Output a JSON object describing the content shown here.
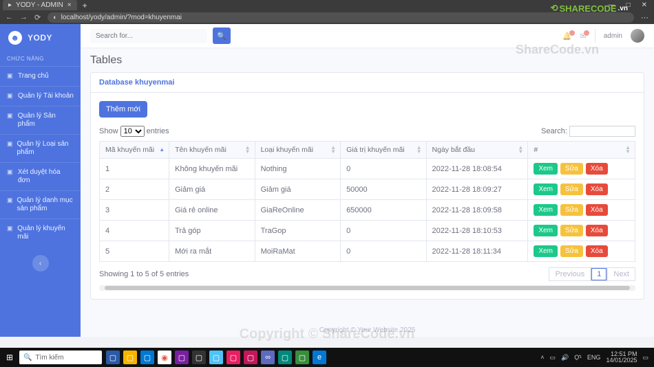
{
  "browser": {
    "tab_title": "YODY - ADMIN",
    "url": "localhost/yody/admin/?mod=khuyenmai"
  },
  "watermark_tagline": "ShareCode.vn",
  "watermark_copyright": "Copyright © ShareCode.vn",
  "share_logo_a": "SHARECODE",
  "share_logo_b": ".vn",
  "app": {
    "brand": "YODY",
    "sidebar_section": "CHỨC NĂNG",
    "menu": [
      "Trang chủ",
      "Quản lý Tài khoản",
      "Quản lý Sản phẩm",
      "Quản lý Loại sản phẩm",
      "Xét duyệt hóa đơn",
      "Quản lý danh mục sản phẩm",
      "Quản lý khuyến mãi"
    ],
    "collapse_glyph": "‹"
  },
  "topbar": {
    "search_placeholder": "Search for...",
    "username": "admin"
  },
  "page": {
    "title": "Tables",
    "card_title": "Database khuyenmai",
    "add_button": "Thêm mới"
  },
  "datatable": {
    "length_pre": "Show",
    "length_value": "10",
    "length_post": "entries",
    "search_label": "Search:",
    "info": "Showing 1 to 5 of 5 entries",
    "prev": "Previous",
    "page": "1",
    "next": "Next",
    "columns": [
      "Mã khuyến mãi",
      "Tên khuyến mãi",
      "Loại khuyến mãi",
      "Giá trị khuyến mãi",
      "Ngày bắt đầu",
      "#"
    ],
    "actions": {
      "view": "Xem",
      "edit": "Sửa",
      "del": "Xóa"
    },
    "rows": [
      {
        "id": "1",
        "name": "Không khuyến mãi",
        "type": "Nothing",
        "value": "0",
        "start": "2022-11-28 18:08:54"
      },
      {
        "id": "2",
        "name": "Giảm giá",
        "type": "Giảm giá",
        "value": "50000",
        "start": "2022-11-28 18:09:27"
      },
      {
        "id": "3",
        "name": "Giá rẻ online",
        "type": "GiaReOnline",
        "value": "650000",
        "start": "2022-11-28 18:09:58"
      },
      {
        "id": "4",
        "name": "Trả góp",
        "type": "TraGop",
        "value": "0",
        "start": "2022-11-28 18:10:53"
      },
      {
        "id": "5",
        "name": "Mới ra mắt",
        "type": "MoiRaMat",
        "value": "0",
        "start": "2022-11-28 18:11:34"
      }
    ]
  },
  "footer": "Copyright © Your Website 2025",
  "taskbar": {
    "search_placeholder": "Tìm kiếm",
    "lang": "ENG",
    "ime": "Ợ¹",
    "time": "12:51 PM",
    "date": "14/01/2025"
  }
}
